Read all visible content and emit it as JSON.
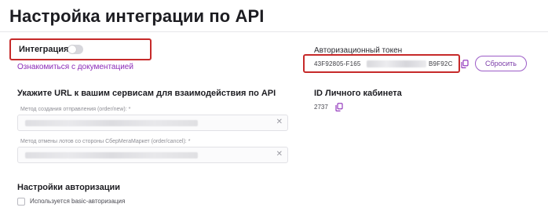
{
  "page": {
    "title": "Настройка интеграции по API"
  },
  "integration": {
    "label": "Интеграция",
    "enabled": false,
    "docs_link": "Ознакомиться с документацией"
  },
  "urls": {
    "heading": "Укажите URL к вашим сервисам для взаимодействия по API",
    "fields": [
      {
        "label": "Метод создания отправления (order/new): *",
        "value": "",
        "clear_icon": "close-icon"
      },
      {
        "label": "Метод отмены лотов со стороны СберМегаМаркет (order/cancel): *",
        "value": "",
        "clear_icon": "close-icon"
      }
    ]
  },
  "auth": {
    "heading": "Настройки авторизации",
    "checkbox_label": "Используется basic-авторизация",
    "checked": false
  },
  "token": {
    "label": "Авторизационный токен",
    "start": "43F92805-F165",
    "end": "B9F92C",
    "copy_icon": "copy-icon",
    "reset_label": "Сбросить"
  },
  "cabinet": {
    "label": "ID Личного кабинета",
    "id": "2737",
    "copy_icon": "copy-icon"
  },
  "colors": {
    "accent": "#8b2ab8",
    "highlight": "#c62a2a"
  }
}
